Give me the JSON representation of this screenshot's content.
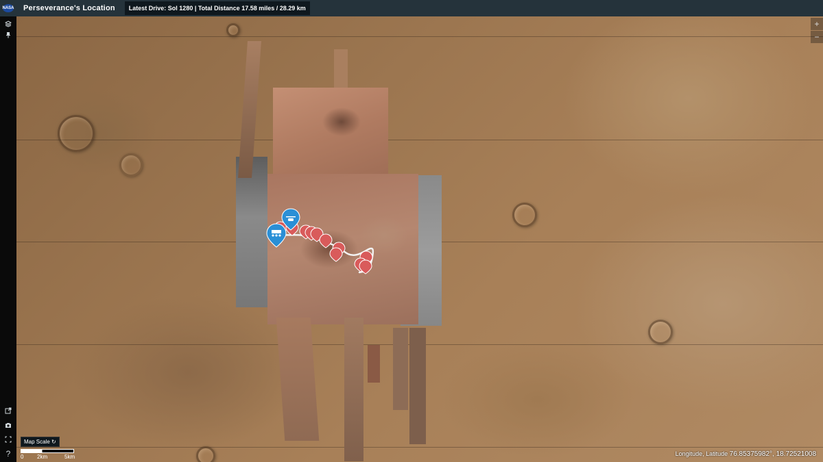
{
  "header": {
    "logo_text": "NASA",
    "title": "Perseverance's Location",
    "drive_info": "Latest Drive: Sol 1280 | Total Distance 17.58 miles / 28.29 km"
  },
  "toolbar": {
    "icons": [
      "layers-icon",
      "pin-icon",
      "external-link-icon",
      "camera-icon",
      "fullscreen-icon",
      "help-icon"
    ],
    "help_symbol": "?"
  },
  "map_controls": {
    "zoom_in": "+",
    "zoom_out": "−"
  },
  "scale": {
    "label": "Map Scale",
    "ticks": [
      "0",
      "2km",
      "5km"
    ]
  },
  "coordinates": {
    "label": "Longitude, Latitude",
    "value": "76.85375982°, 18.72521008"
  },
  "markers": {
    "rover": "rover-marker",
    "helicopter": "helicopter-marker",
    "waypoint_count": 12
  },
  "colors": {
    "topbar": "#25333b",
    "rover_marker": "#2a8fd6",
    "waypoint_marker": "#d95b5b",
    "path": "#ffffff"
  }
}
